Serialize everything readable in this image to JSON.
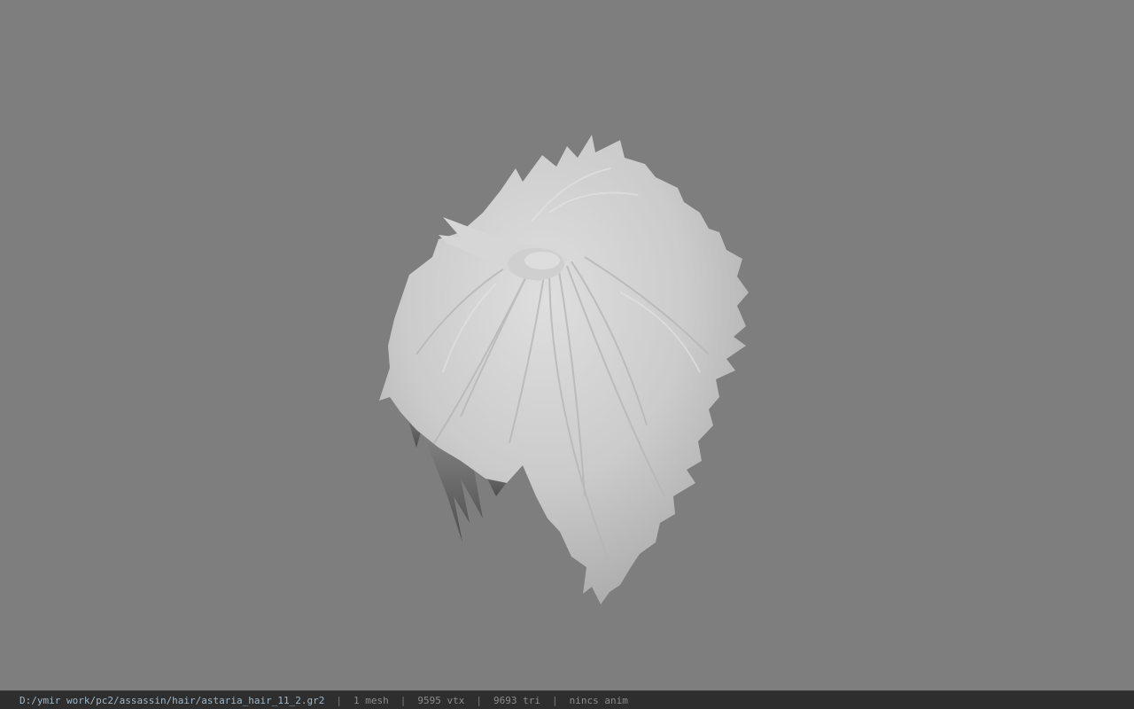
{
  "viewport": {
    "background_color": "#7e7e7e",
    "model_color": "#c9c9c9"
  },
  "statusbar": {
    "file_path": "D:/ymir work/pc2/assassin/hair/astaria_hair_11_2.gr2",
    "separator": "|",
    "mesh_count": "1 mesh",
    "vertex_count": "9595 vtx",
    "triangle_count": "9693 tri",
    "animation": "nincs anim"
  }
}
